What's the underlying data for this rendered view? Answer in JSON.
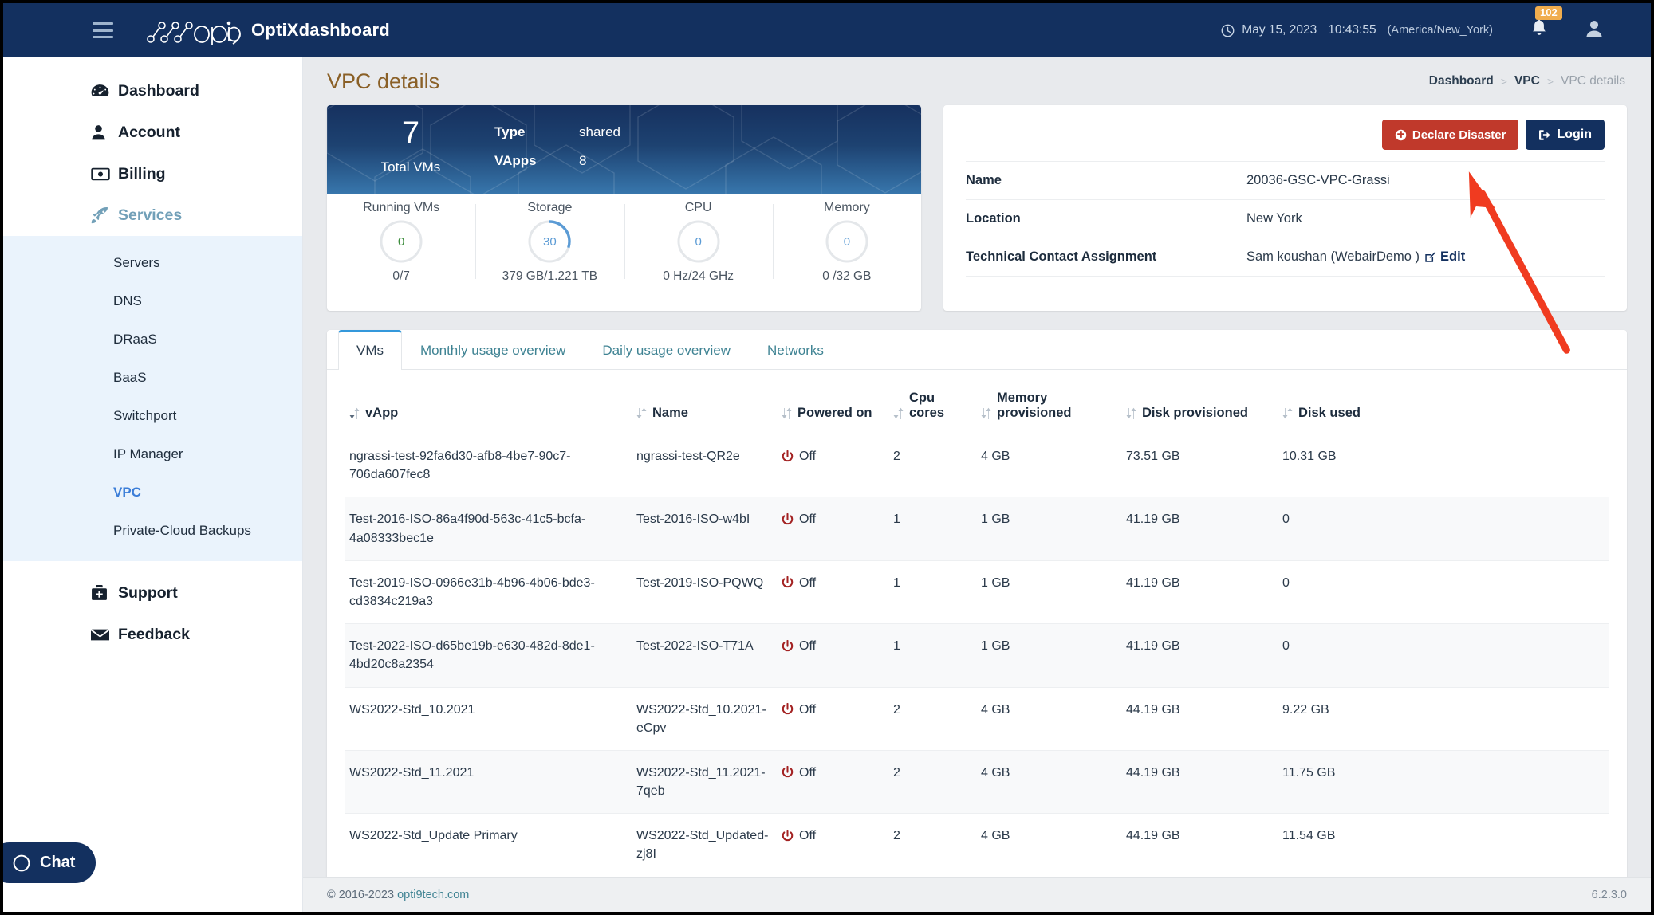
{
  "topnav": {
    "menu_icon": "hamburger-icon",
    "logo_text": "opti9",
    "brand": "OptiXdashboard",
    "clock_icon": "clock-icon",
    "date": "May 15, 2023",
    "time": "10:43:55",
    "timezone": "(America/New_York)",
    "notifications_icon": "bell-icon",
    "notifications_count": "102",
    "user_icon": "user-icon"
  },
  "sidebar": {
    "items": [
      {
        "label": "Dashboard",
        "icon": "gauge-icon",
        "active": false
      },
      {
        "label": "Account",
        "icon": "user-icon",
        "active": false
      },
      {
        "label": "Billing",
        "icon": "money-bill-icon",
        "active": false
      },
      {
        "label": "Services",
        "icon": "rocket-icon",
        "active": true
      }
    ],
    "subitems": [
      {
        "label": "Servers",
        "active": false
      },
      {
        "label": "DNS",
        "active": false
      },
      {
        "label": "DRaaS",
        "active": false
      },
      {
        "label": "BaaS",
        "active": false
      },
      {
        "label": "Switchport",
        "active": false
      },
      {
        "label": "IP Manager",
        "active": false
      },
      {
        "label": "VPC",
        "active": true
      },
      {
        "label": "Private-Cloud Backups",
        "active": false
      }
    ],
    "bottom_items": [
      {
        "label": "Support",
        "icon": "briefcase-medical-icon"
      },
      {
        "label": "Feedback",
        "icon": "envelope-icon"
      }
    ]
  },
  "page": {
    "title": "VPC details",
    "breadcrumb": [
      {
        "label": "Dashboard",
        "current": false
      },
      {
        "label": "VPC",
        "current": false
      },
      {
        "label": "VPC details",
        "current": true
      }
    ],
    "breadcrumb_separator": ">"
  },
  "stats_card": {
    "total_vms_value": "7",
    "total_vms_label": "Total VMs",
    "type_label": "Type",
    "type_value": "shared",
    "vapps_label": "VApps",
    "vapps_value": "8",
    "metrics": [
      {
        "label": "Running VMs",
        "value": "0",
        "percent": 0,
        "sub": "0/7",
        "color": "#3b8c3b"
      },
      {
        "label": "Storage",
        "value": "30",
        "percent": 30,
        "sub": "379 GB/1.221 TB",
        "color": "#5b9bd5"
      },
      {
        "label": "CPU",
        "value": "0",
        "percent": 0,
        "sub": "0 Hz/24 GHz",
        "color": "#5b9bd5"
      },
      {
        "label": "Memory",
        "value": "0",
        "percent": 0,
        "sub": "0 /32 GB",
        "color": "#5b9bd5"
      }
    ]
  },
  "info_card": {
    "declare_disaster_label": "Declare Disaster",
    "declare_disaster_icon": "exclamation-circle-icon",
    "login_label": "Login",
    "login_icon": "sign-in-icon",
    "rows": [
      {
        "key": "Name",
        "value": "20036-GSC-VPC-Grassi"
      },
      {
        "key": "Location",
        "value": "New York"
      },
      {
        "key": "Technical Contact Assignment",
        "value": "Sam koushan (WebairDemo )"
      }
    ],
    "edit_label": "Edit",
    "edit_icon": "pencil-square-icon"
  },
  "tabs": [
    {
      "label": "VMs",
      "active": true
    },
    {
      "label": "Monthly usage overview",
      "active": false
    },
    {
      "label": "Daily usage overview",
      "active": false
    },
    {
      "label": "Networks",
      "active": false
    }
  ],
  "table": {
    "columns": [
      "vApp",
      "Name",
      "Powered on",
      "Cpu cores",
      "Memory provisioned",
      "Disk provisioned",
      "Disk used"
    ],
    "sort_icon": "sort-icon",
    "power_icon": "power-off-icon",
    "rows": [
      {
        "vapp": "ngrassi-test-92fa6d30-afb8-4be7-90c7-706da607fec8",
        "name": "ngrassi-test-QR2e",
        "powered_on": "Off",
        "cpu_cores": "2",
        "memory": "4 GB",
        "disk_provisioned": "73.51 GB",
        "disk_used": "10.31 GB"
      },
      {
        "vapp": "Test-2016-ISO-86a4f90d-563c-41c5-bcfa-4a08333bec1e",
        "name": "Test-2016-ISO-w4bI",
        "powered_on": "Off",
        "cpu_cores": "1",
        "memory": "1 GB",
        "disk_provisioned": "41.19 GB",
        "disk_used": "0"
      },
      {
        "vapp": "Test-2019-ISO-0966e31b-4b96-4b06-bde3-cd3834c219a3",
        "name": "Test-2019-ISO-PQWQ",
        "powered_on": "Off",
        "cpu_cores": "1",
        "memory": "1 GB",
        "disk_provisioned": "41.19 GB",
        "disk_used": "0"
      },
      {
        "vapp": "Test-2022-ISO-d65be19b-e630-482d-8de1-4bd20c8a2354",
        "name": "Test-2022-ISO-T71A",
        "powered_on": "Off",
        "cpu_cores": "1",
        "memory": "1 GB",
        "disk_provisioned": "41.19 GB",
        "disk_used": "0"
      },
      {
        "vapp": "WS2022-Std_10.2021",
        "name": "WS2022-Std_10.2021-eCpv",
        "powered_on": "Off",
        "cpu_cores": "2",
        "memory": "4 GB",
        "disk_provisioned": "44.19 GB",
        "disk_used": "9.22 GB"
      },
      {
        "vapp": "WS2022-Std_11.2021",
        "name": "WS2022-Std_11.2021-7qeb",
        "powered_on": "Off",
        "cpu_cores": "2",
        "memory": "4 GB",
        "disk_provisioned": "44.19 GB",
        "disk_used": "11.75 GB"
      },
      {
        "vapp": "WS2022-Std_Update Primary",
        "name": "WS2022-Std_Updated-zj8I",
        "powered_on": "Off",
        "cpu_cores": "2",
        "memory": "4 GB",
        "disk_provisioned": "44.19 GB",
        "disk_used": "11.54 GB"
      }
    ]
  },
  "footer": {
    "copyright": "© 2016-2023",
    "site": "opti9tech.com",
    "version": "6.2.3.0"
  },
  "chat": {
    "label": "Chat",
    "icon": "chat-bubble-icon"
  },
  "annotation": {
    "type": "arrow",
    "color": "#f03b20",
    "points_to": "Declare Disaster"
  },
  "colors": {
    "nav_bg": "#13305f",
    "accent_blue": "#3498db",
    "danger": "#c0392b",
    "title": "#8a6027",
    "badge": "#f0ad4e"
  }
}
